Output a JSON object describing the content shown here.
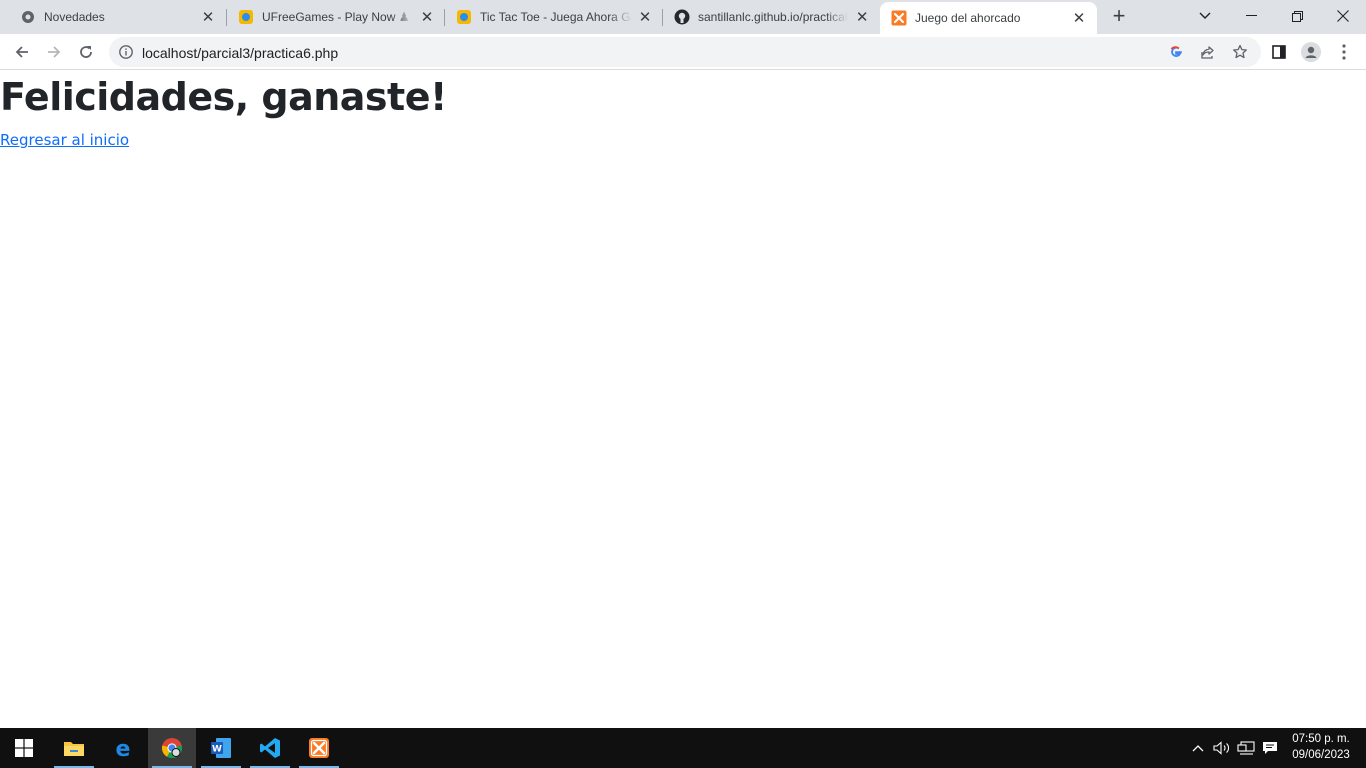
{
  "browser": {
    "tabs": [
      {
        "title": "Novedades",
        "icon": "chrome-settings-icon"
      },
      {
        "title": "UFreeGames - Play Now ♟ Play",
        "icon": "ufreegames-icon"
      },
      {
        "title": "Tic Tac Toe - Juega Ahora Gratis",
        "icon": "ufreegames-icon"
      },
      {
        "title": "santillanlc.github.io/practica6",
        "icon": "github-icon"
      },
      {
        "title": "Juego del ahorcado",
        "icon": "xampp-icon",
        "active": true
      }
    ],
    "address": {
      "url": "localhost/parcial3/practica6.php"
    }
  },
  "page": {
    "heading": "Felicidades, ganaste!",
    "link": "Regresar al inicio"
  },
  "taskbar": {
    "apps": [
      "start",
      "file-explorer",
      "edge",
      "chrome",
      "word",
      "vscode",
      "xampp"
    ],
    "clock": {
      "time": "07:50 p. m.",
      "date": "09/06/2023"
    }
  },
  "colors": {
    "tabstrip": "#dee1e6",
    "link": "#0d6efd",
    "heading": "#212529",
    "taskbar": "#101010"
  }
}
